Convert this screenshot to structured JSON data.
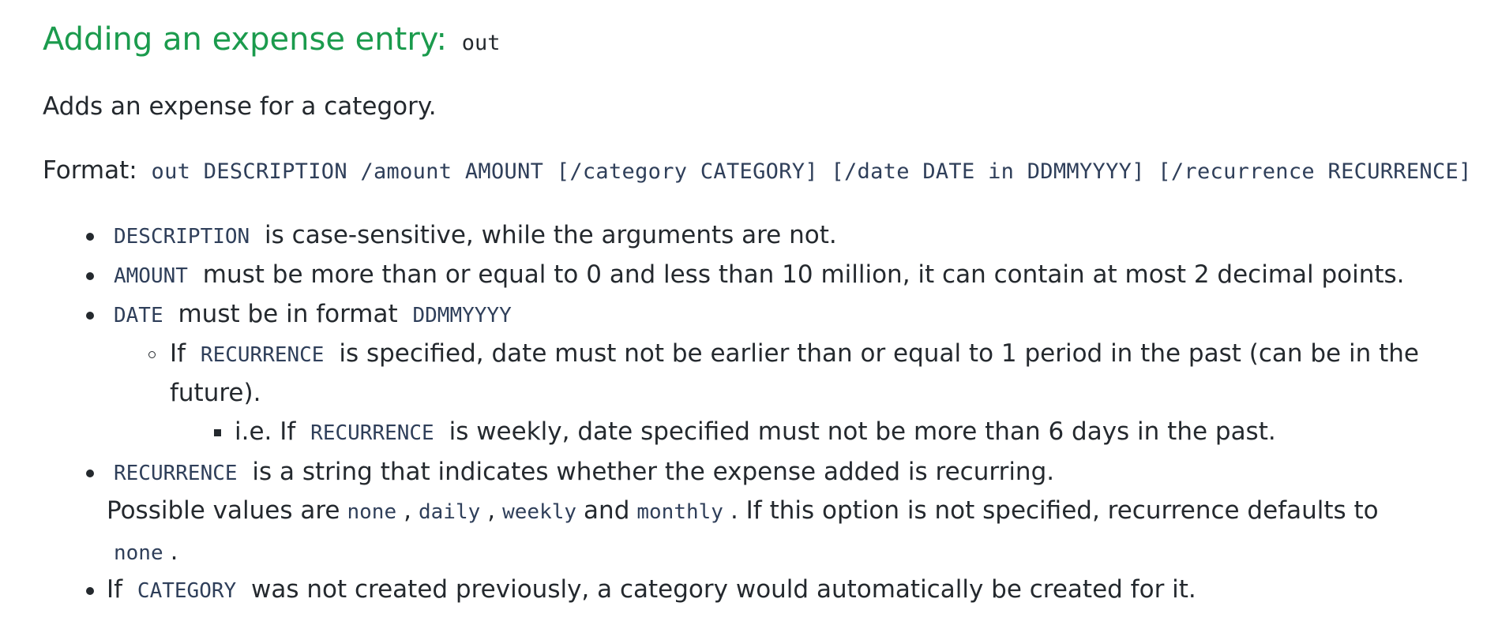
{
  "heading": {
    "title": "Adding an expense entry:",
    "command": "out"
  },
  "description": "Adds an expense for a category.",
  "format": {
    "label": "Format:",
    "syntax": "out DESCRIPTION /amount AMOUNT [/category CATEGORY] [/date DATE in DDMMYYYY] [/recurrence RECURRENCE]"
  },
  "bullets": {
    "description": {
      "code": "DESCRIPTION",
      "text": "is case-sensitive, while the arguments are not."
    },
    "amount": {
      "code": "AMOUNT",
      "text": "must be more than or equal to 0 and less than 10 million, it can contain at most 2 decimal points."
    },
    "date": {
      "code": "DATE",
      "text": "must be in format",
      "format_code": "DDMMYYYY",
      "sub": {
        "prefix": "If",
        "code": "RECURRENCE",
        "text": "is specified, date must not be earlier than or equal to 1 period in the past (can be in the",
        "text_cont": "future).",
        "subsub": {
          "prefix": "i.e. If",
          "code": "RECURRENCE",
          "text": "is weekly, date specified must not be more than 6 days in the past."
        }
      }
    },
    "recurrence": {
      "code": "RECURRENCE",
      "text": "is a string that indicates whether the expense added is recurring.",
      "possible_prefix": "Possible values are",
      "values": [
        "none",
        "daily",
        "weekly",
        "monthly"
      ],
      "comma": ",",
      "and_word": "and",
      "suffix": ". If this option is not specified, recurrence defaults to",
      "default_code": "none",
      "period": "."
    },
    "category": {
      "prefix": "If",
      "code": "CATEGORY",
      "text": "was not created previously, a category would automatically be created for it."
    }
  }
}
